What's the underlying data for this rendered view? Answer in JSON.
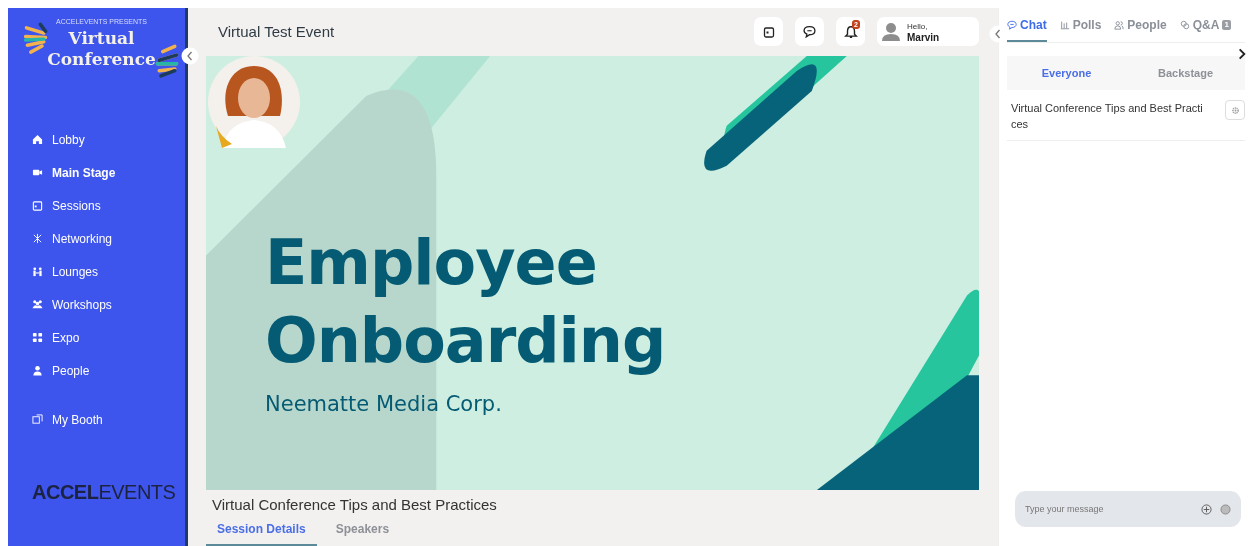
{
  "sidebar": {
    "brand_kicker": "ACCELEVENTS PRESENTS",
    "brand_title": "Virtual Conference",
    "items": [
      {
        "label": "Lobby",
        "kind": "home",
        "selected": false
      },
      {
        "label": "Main Stage",
        "kind": "camera",
        "selected": true
      },
      {
        "label": "Sessions",
        "kind": "calendar",
        "selected": false
      },
      {
        "label": "Networking",
        "kind": "network",
        "selected": false
      },
      {
        "label": "Lounges",
        "kind": "lounge",
        "selected": false
      },
      {
        "label": "Workshops",
        "kind": "group",
        "selected": false
      },
      {
        "label": "Expo",
        "kind": "grid",
        "selected": false
      },
      {
        "label": "People",
        "kind": "person",
        "selected": false
      },
      {
        "label": "My Booth",
        "kind": "booth",
        "selected": false
      }
    ],
    "footer_logo": "**ACCEL**EVENTS"
  },
  "header": {
    "title": "Virtual Test Event",
    "notification_count": "2",
    "greeting": "Hello,",
    "user_name": "Marvin"
  },
  "stage": {
    "headline": "Employee Onboarding",
    "company": "Neematte Media Corp."
  },
  "session": {
    "title": "Virtual Conference Tips and Best Practices",
    "tabs": [
      {
        "label": "Session Details",
        "selected": true
      },
      {
        "label": "Speakers",
        "selected": false
      }
    ]
  },
  "panel": {
    "tabs": [
      {
        "label": "Chat",
        "kind": "chat",
        "selected": true
      },
      {
        "label": "Polls",
        "kind": "poll",
        "selected": false
      },
      {
        "label": "People",
        "kind": "people",
        "selected": false
      },
      {
        "label": "Q&A",
        "kind": "qa",
        "selected": false,
        "badge": "1"
      }
    ],
    "subtabs": [
      {
        "label": "Everyone",
        "selected": true
      },
      {
        "label": "Backstage",
        "selected": false
      }
    ],
    "topic": "Virtual Conference Tips and Best Practices",
    "message_placeholder": "Type your message"
  }
}
